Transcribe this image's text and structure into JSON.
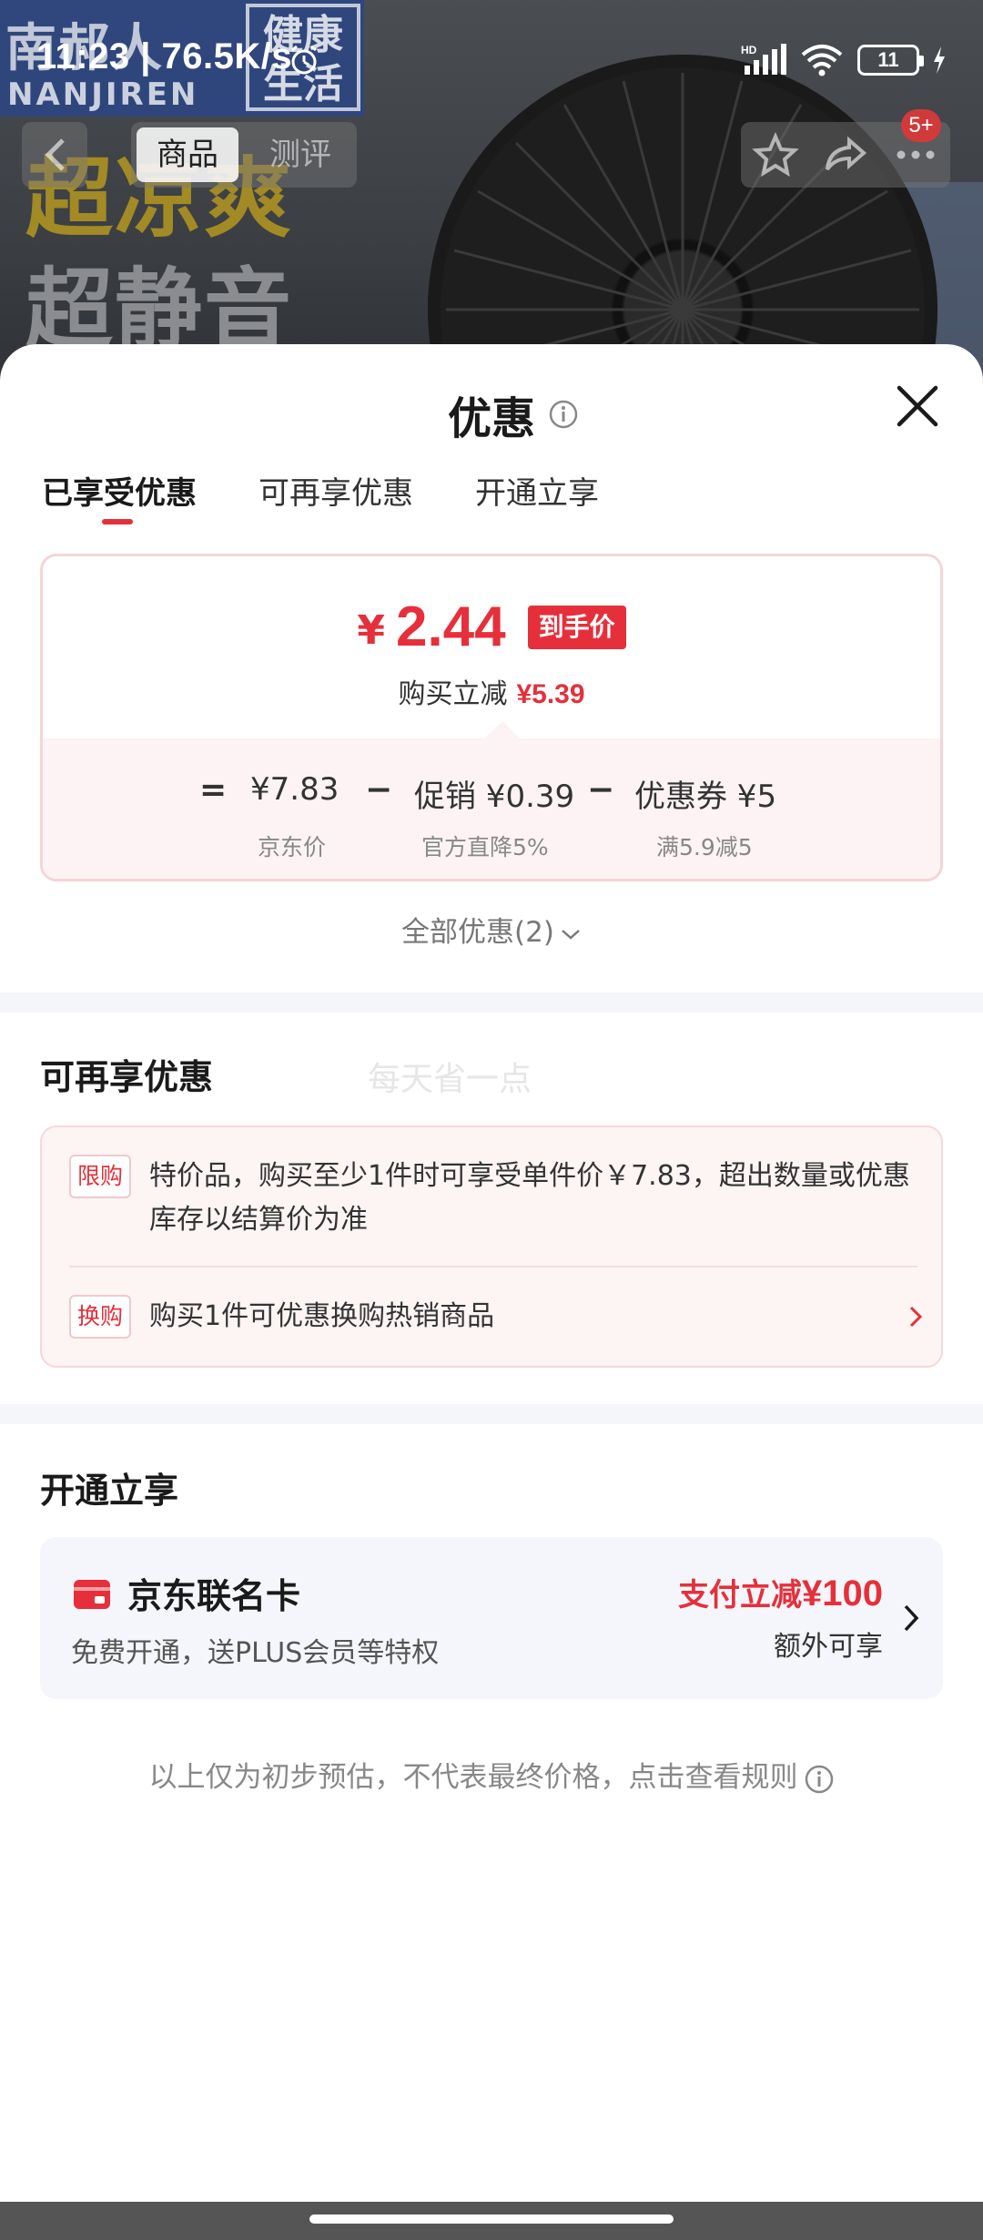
{
  "status_bar": {
    "time": "11:23",
    "speed": "76.5K/s",
    "battery": "11",
    "network_label": "HD"
  },
  "background": {
    "brand_main": "南郝人",
    "brand_sub": "NANJIREN",
    "brand_tag": "健康生活",
    "headline_1": "超凉爽",
    "headline_2": "超静音"
  },
  "top_nav": {
    "tabs": [
      "商品",
      "测评"
    ],
    "badge": "5+"
  },
  "sheet": {
    "title": "优惠",
    "tabs": [
      "已享受优惠",
      "可再享优惠",
      "开通立享"
    ],
    "active_tab": 0
  },
  "price_card": {
    "currency": "¥",
    "final_price": "2.44",
    "final_tag": "到手价",
    "saving_label": "购买立减",
    "saving_value": "¥5.39",
    "formula": {
      "eq": "=",
      "base": "¥7.83",
      "minus1": "−",
      "promo": "促销 ¥0.39",
      "minus2": "−",
      "coupon": "优惠券 ¥5"
    },
    "notes": {
      "base": "京东价",
      "promo": "官方直降5%",
      "coupon": "满5.9减5"
    }
  },
  "all_offers": "全部优惠(2)",
  "more_offers": {
    "title": "可再享优惠",
    "watermark": "每天省一点",
    "items": [
      {
        "tag": "限购",
        "text": "特价品，购买至少1件时可享受单件价￥7.83，超出数量或优惠库存以结算价为准"
      },
      {
        "tag": "换购",
        "text": "购买1件可优惠换购热销商品"
      }
    ]
  },
  "open_now": {
    "title": "开通立享",
    "card_name": "京东联名卡",
    "card_desc": "免费开通，送PLUS会员等特权",
    "promo_prefix": "支付立减",
    "promo_amount": "¥100",
    "extra": "额外可享"
  },
  "disclaimer": "以上仅为初步预估，不代表最终价格，点击查看规则",
  "colors": {
    "accent": "#e5303b",
    "card_border": "#f6d4d6",
    "card_bg": "#fdf3f4",
    "section_divider": "#f4f6fa"
  }
}
